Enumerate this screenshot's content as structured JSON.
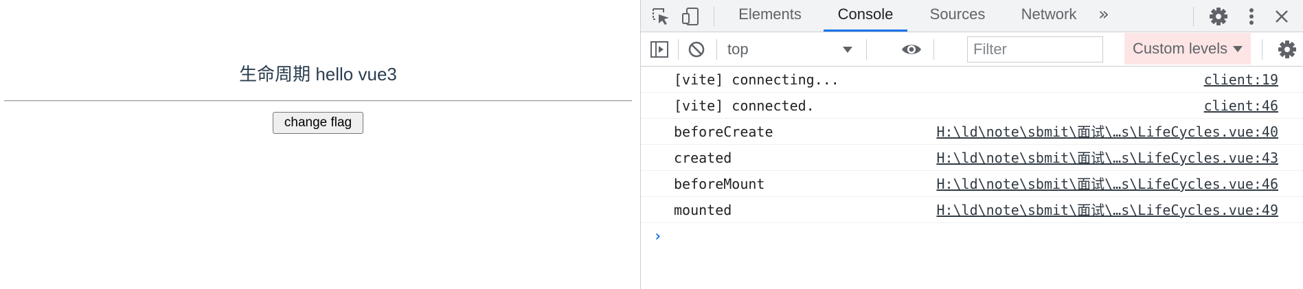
{
  "page": {
    "heading": "生命周期 hello vue3",
    "button_label": "change flag"
  },
  "devtools": {
    "tabs": [
      {
        "label": "Elements",
        "active": false
      },
      {
        "label": "Console",
        "active": true
      },
      {
        "label": "Sources",
        "active": false
      },
      {
        "label": "Network",
        "active": false
      }
    ],
    "more_tabs_label": "»",
    "toolbar": {
      "context_value": "top",
      "filter_placeholder": "Filter",
      "levels_label": "Custom levels"
    },
    "icons": [
      "inspect-element-icon",
      "device-toggle-icon",
      "gear-icon",
      "kebab-menu-icon",
      "close-icon",
      "sidebar-toggle-icon",
      "clear-console-icon",
      "eye-icon",
      "console-settings-gear-icon"
    ],
    "messages": [
      {
        "text": "[vite] connecting...",
        "source": "client:19"
      },
      {
        "text": "[vite] connected.",
        "source": "client:46"
      },
      {
        "text": "beforeCreate",
        "source": "H:\\ld\\note\\sbmit\\面试\\…s\\LifeCycles.vue:40"
      },
      {
        "text": "created",
        "source": "H:\\ld\\note\\sbmit\\面试\\…s\\LifeCycles.vue:43"
      },
      {
        "text": "beforeMount",
        "source": "H:\\ld\\note\\sbmit\\面试\\…s\\LifeCycles.vue:46"
      },
      {
        "text": "mounted",
        "source": "H:\\ld\\note\\sbmit\\面试\\…s\\LifeCycles.vue:49"
      }
    ],
    "prompt_symbol": "›",
    "colors": {
      "accent": "#1a73e8",
      "levels_bg": "#fde5e5",
      "heading_text": "#2c3e50"
    }
  }
}
